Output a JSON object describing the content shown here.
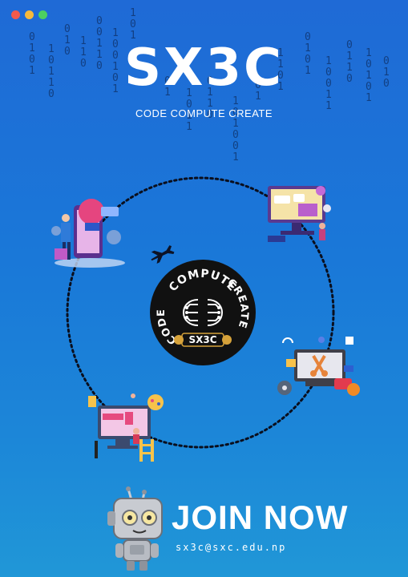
{
  "window_dots": [
    {
      "name": "close",
      "color": "#f25a4c"
    },
    {
      "name": "minimize",
      "color": "#f6b93b"
    },
    {
      "name": "maximize",
      "color": "#4cd060"
    }
  ],
  "title": "SX3C",
  "tagline": "CODE COMPUTE CREATE",
  "badge": {
    "top_text": "COMPUTE",
    "left_text": "CODE",
    "right_text": "CREATE",
    "bottom_text": "SX3C"
  },
  "cta": {
    "label": "JOIN NOW",
    "email": "sx3c@sxc.edu.np"
  },
  "colors": {
    "background_top": "#1f6ad6",
    "background_bottom": "#2097d7",
    "badge": "#111111",
    "text": "#ffffff"
  },
  "icons": [
    "robot-icon",
    "airplane-icon",
    "circuit-icon"
  ]
}
